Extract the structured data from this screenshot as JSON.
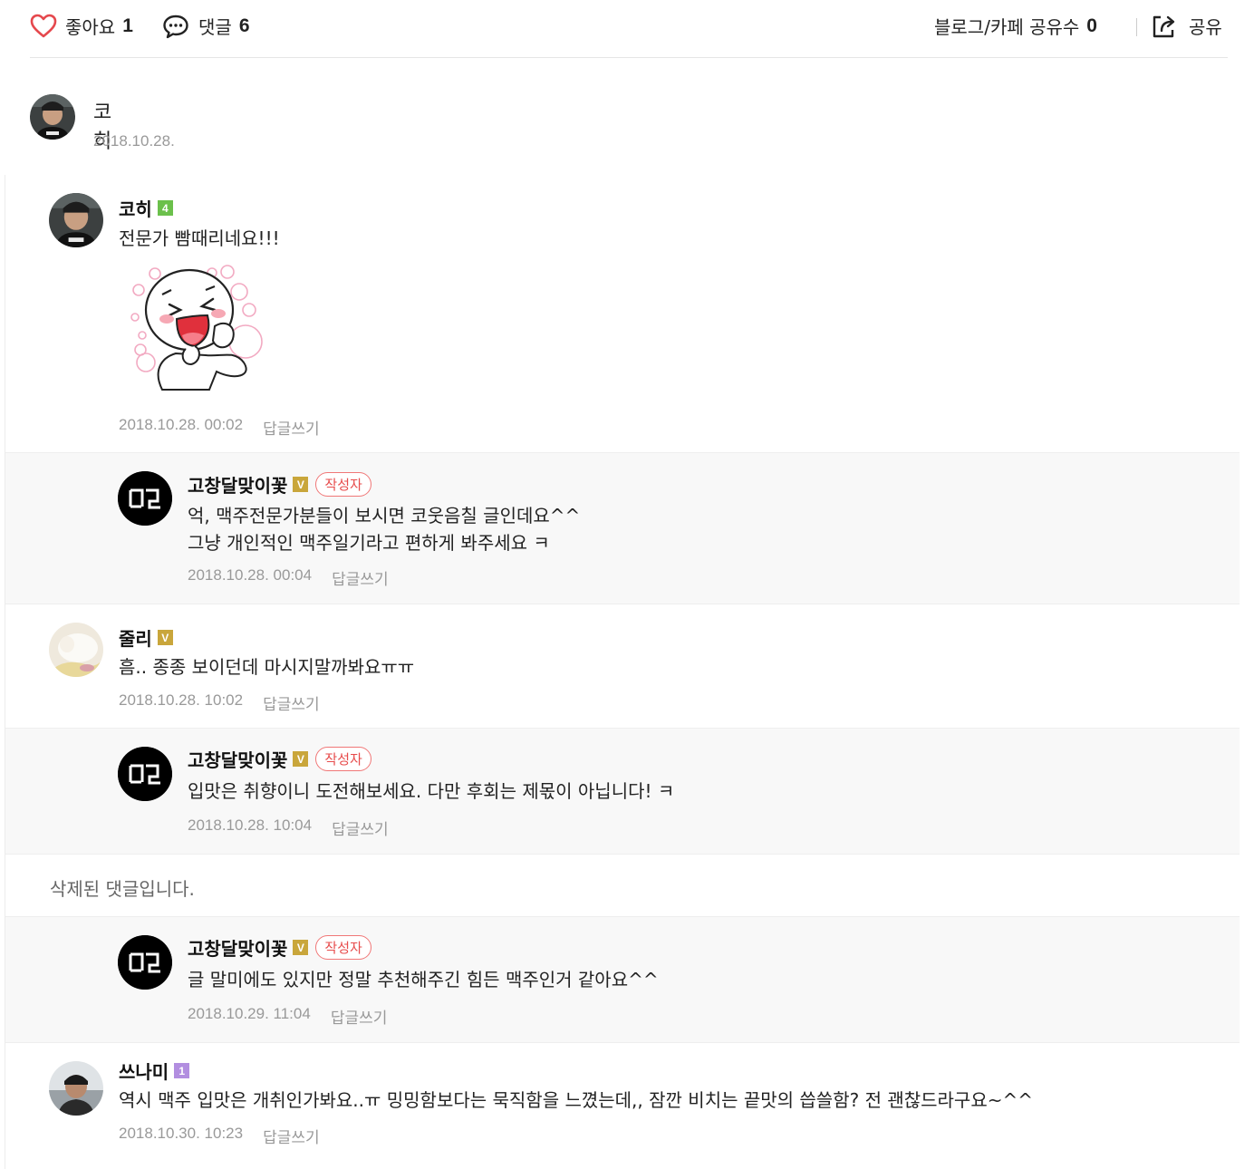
{
  "topbar": {
    "like_label": "좋아요",
    "like_count": "1",
    "comment_label": "댓글",
    "comment_count": "6",
    "share_count_label": "블로그/카페 공유수",
    "share_count": "0",
    "share_label": "공유"
  },
  "author": {
    "name": "코히",
    "date": "2018.10.28."
  },
  "comments": [
    {
      "name": "코히",
      "badge": "4",
      "text": "전문가 빰때리네요!!!",
      "date": "2018.10.28. 00:02",
      "reply_label": "답글쓰기"
    },
    {
      "name": "고창달맞이꽃",
      "badge": "V",
      "writer_tag": "작성자",
      "text": "억, 맥주전문가분들이 보시면 코웃음칠 글인데요^^\n그냥 개인적인 맥주일기라고 편하게 봐주세요 ㅋ",
      "date": "2018.10.28. 00:04",
      "reply_label": "답글쓰기"
    },
    {
      "name": "줄리",
      "badge": "V",
      "text": "흠.. 종종 보이던데 마시지말까봐요ㅠㅠ",
      "date": "2018.10.28. 10:02",
      "reply_label": "답글쓰기"
    },
    {
      "name": "고창달맞이꽃",
      "badge": "V",
      "writer_tag": "작성자",
      "text": "입맛은 취향이니 도전해보세요. 다만 후회는 제몫이 아닙니다! ㅋ",
      "date": "2018.10.28. 10:04",
      "reply_label": "답글쓰기"
    },
    {
      "deleted_text": "삭제된 댓글입니다."
    },
    {
      "name": "고창달맞이꽃",
      "badge": "V",
      "writer_tag": "작성자",
      "text": "글 말미에도 있지만 정말 추천해주긴 힘든 맥주인거 같아요^^",
      "date": "2018.10.29. 11:04",
      "reply_label": "답글쓰기"
    },
    {
      "name": "쓰나미",
      "badge": "1",
      "text": "역시 맥주 입맛은 개취인가봐요..ㅠ 밍밍함보다는 묵직함을 느꼈는데,, 잠깐 비치는 끝맛의 씁쓸함? 전 괜찮드라구요~^^",
      "date": "2018.10.30. 10:23",
      "reply_label": "답글쓰기"
    }
  ],
  "logo_text": "고달",
  "colors": {
    "heart": "#e5484d",
    "writer_tag": "#e74c4c",
    "badge_level4": "#6bc04b",
    "badge_v": "#c9a63b",
    "badge_level1": "#b28ee0",
    "reply_bg": "#f8f8f8"
  },
  "icons": [
    "heart-icon",
    "comment-bubble-icon",
    "share-icon"
  ]
}
